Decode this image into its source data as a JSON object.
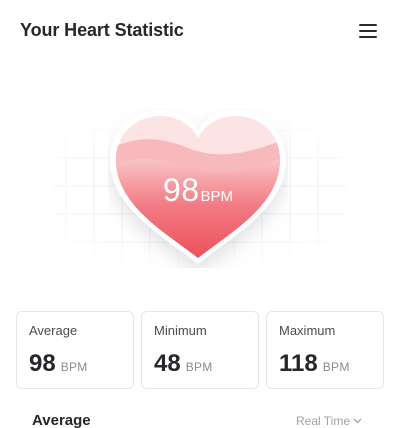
{
  "header": {
    "title": "Your Heart Statistic",
    "menu_icon": "hamburger-menu-icon"
  },
  "heart": {
    "bpm_value": "98",
    "bpm_unit": "BPM",
    "colors": {
      "fill_top": "#fbe2e3",
      "fill_bottom": "#ef4f5b",
      "wave": "#f48a90"
    }
  },
  "stats": [
    {
      "label": "Average",
      "value": "98",
      "unit": "BPM"
    },
    {
      "label": "Minimum",
      "value": "48",
      "unit": "BPM"
    },
    {
      "label": "Maximum",
      "value": "118",
      "unit": "BPM"
    }
  ],
  "chart_section": {
    "title": "Average",
    "range_selected": "Real Time",
    "range_icon": "chevron-down-icon"
  }
}
